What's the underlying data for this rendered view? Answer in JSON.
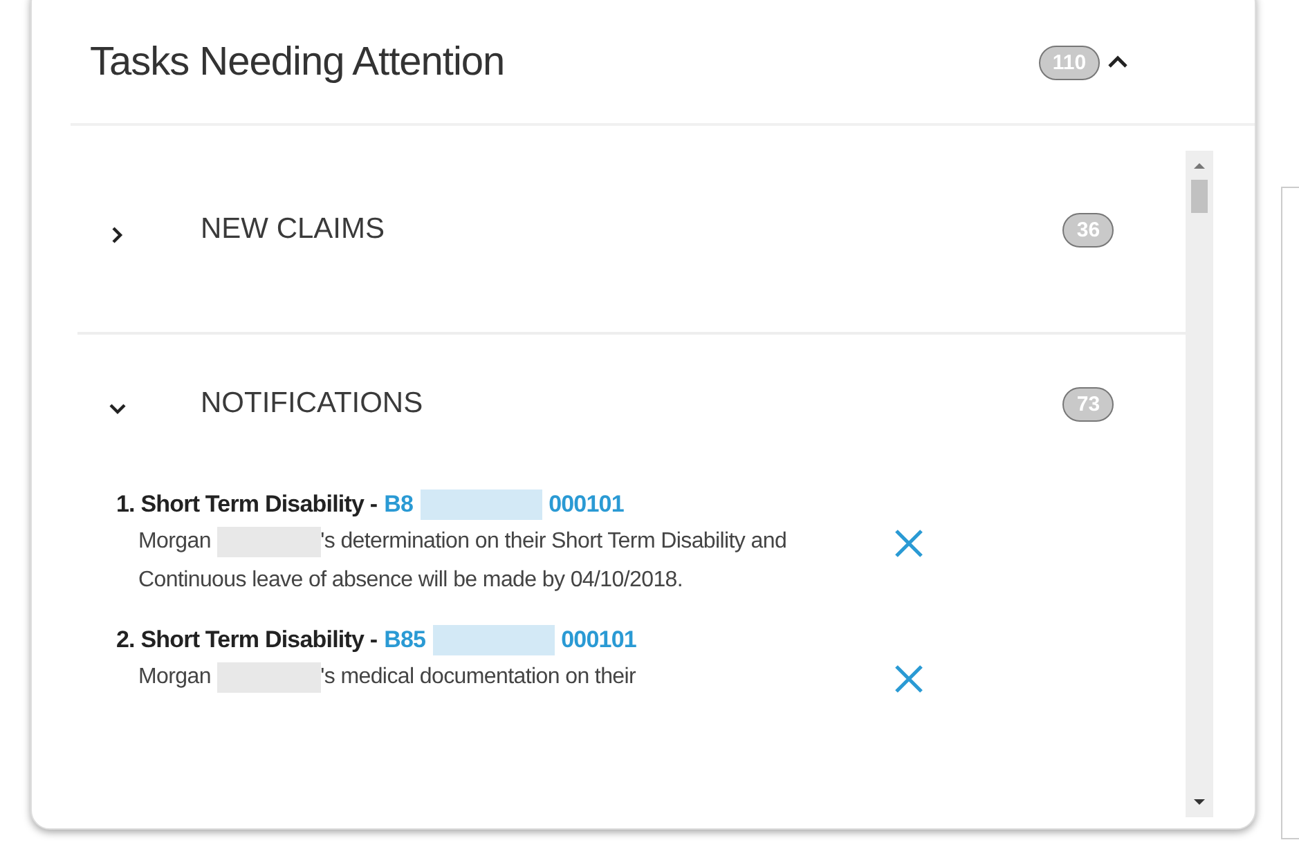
{
  "panel": {
    "title": "Tasks Needing Attention",
    "count": "110",
    "expanded": true
  },
  "sections": [
    {
      "title": "NEW CLAIMS",
      "count": "36",
      "expanded": false
    },
    {
      "title": "NOTIFICATIONS",
      "count": "73",
      "expanded": true,
      "items": [
        {
          "number": "1.",
          "type": "Short Term Disability -",
          "ref_start": "B8",
          "ref_end": "000101",
          "name": "Morgan",
          "text": "'s determination on their Short Term Disability and Continuous leave of absence will be made by 04/10/2018."
        },
        {
          "number": "2.",
          "type": "Short Term Disability -",
          "ref_start": "B85",
          "ref_end": "000101",
          "name": "Morgan",
          "text": "'s medical documentation on their"
        }
      ]
    }
  ]
}
